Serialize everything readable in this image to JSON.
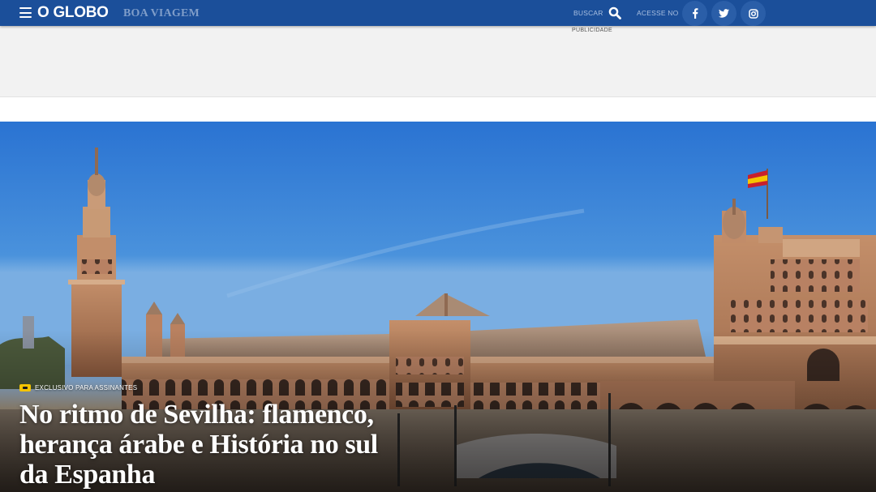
{
  "header": {
    "logo": "O GLOBO",
    "section": "BOA VIAGEM",
    "search_label": "BUSCAR",
    "access_label": "ACESSE NO",
    "social": [
      "facebook-icon",
      "twitter-icon",
      "instagram-icon"
    ],
    "background_color": "#1b4f9a"
  },
  "ad": {
    "label": "PUBLICIDADE"
  },
  "hero": {
    "badge": "EXCLUSIVO PARA ASSINANTES",
    "headline": "No ritmo de Sevilha: flamenco, herança árabe e História no sul da Espanha",
    "image": "plaza-de-espana-sevilla"
  }
}
